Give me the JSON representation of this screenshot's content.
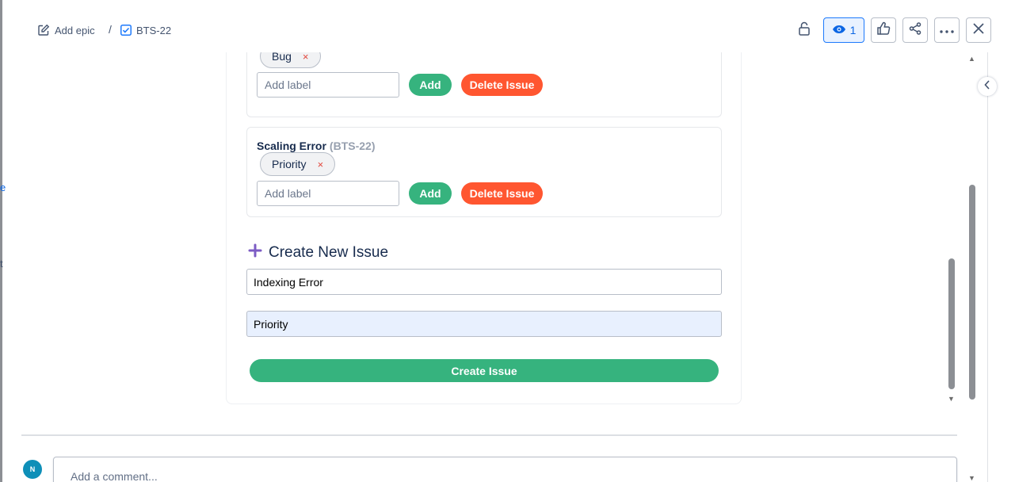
{
  "breadcrumb": {
    "epic_label": "Add epic",
    "separator": "/",
    "issue_key": "BTS-22"
  },
  "header": {
    "watch_count": "1",
    "icons": [
      "unlock-icon",
      "eye-icon",
      "thumbs-up-icon",
      "share-icon",
      "more-icon",
      "close-icon"
    ]
  },
  "issues": [
    {
      "labels": [
        {
          "text": "Bug",
          "remove": "×"
        }
      ],
      "label_placeholder": "Add label",
      "add_label": "Add",
      "delete_label": "Delete Issue"
    },
    {
      "title": "Scaling Error",
      "key": "(BTS-22)",
      "labels": [
        {
          "text": "Priority",
          "remove": "×"
        }
      ],
      "label_placeholder": "Add label",
      "add_label": "Add",
      "delete_label": "Delete Issue"
    }
  ],
  "create": {
    "heading": "Create New Issue",
    "title_value": "Indexing Error",
    "label_value": "Priority",
    "submit_label": "Create Issue"
  },
  "comment": {
    "avatar_initial": "N",
    "placeholder": "Add a comment..."
  },
  "edge_glyphs": [
    "e",
    "t"
  ],
  "colors": {
    "success": "#36b37e",
    "danger": "#ff5630",
    "accent": "#0c66e4",
    "plus": "#7c5cc4",
    "avatar": "#0e8fb8"
  }
}
